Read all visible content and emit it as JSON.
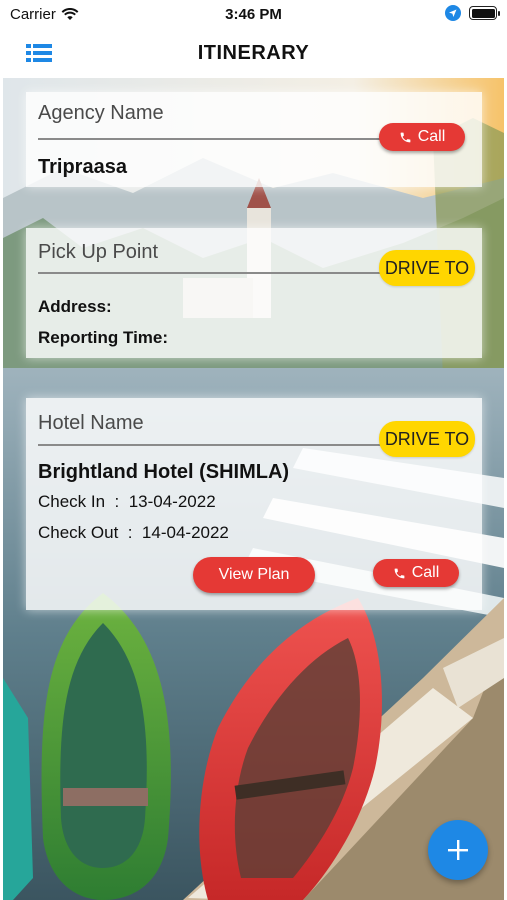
{
  "status_bar": {
    "carrier": "Carrier",
    "time": "3:46 PM"
  },
  "nav": {
    "title": "ITINERARY"
  },
  "agency": {
    "label": "Agency Name",
    "value": "Tripraasa",
    "call_label": "Call"
  },
  "pickup": {
    "label": "Pick Up Point",
    "drive_label": "DRIVE TO",
    "address_label": "Address:",
    "reporting_label": "Reporting Time:"
  },
  "hotel": {
    "label": "Hotel Name",
    "drive_label": "DRIVE TO",
    "name": "Brightland Hotel (SHIMLA)",
    "check_in": "Check In  :  13-04-2022",
    "check_out": "Check Out  :  14-04-2022",
    "view_plan_label": "View Plan",
    "call_label": "Call"
  },
  "colors": {
    "call": "#e53935",
    "drive": "#ffd600",
    "fab": "#1e88e5",
    "menu_icon": "#1e88e5"
  },
  "icons": {
    "menu": "list-menu-icon",
    "wifi": "wifi-icon",
    "location": "location-arrow-icon",
    "battery": "battery-icon",
    "phone": "phone-icon",
    "add": "plus-icon"
  }
}
